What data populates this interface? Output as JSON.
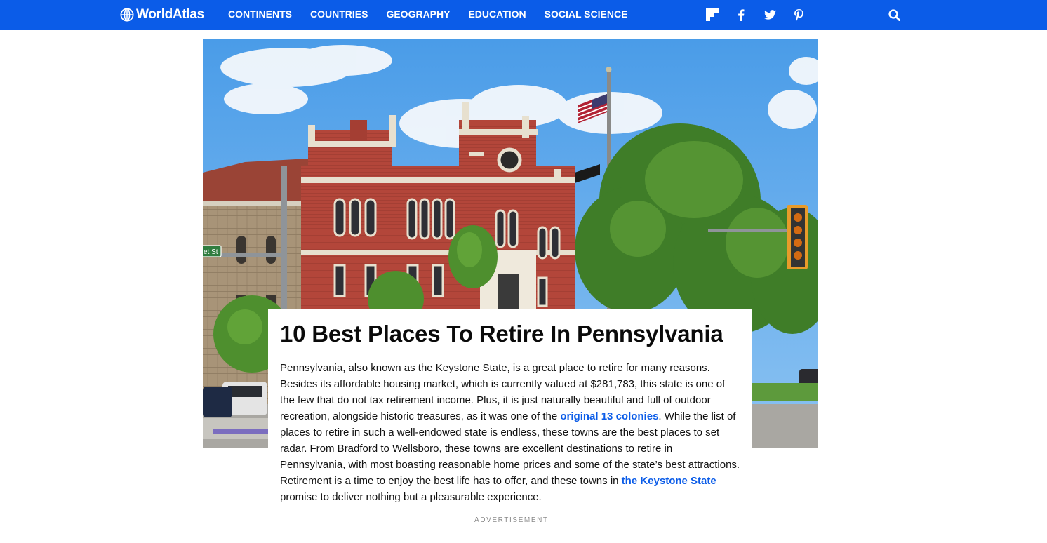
{
  "brand": {
    "name": "WorldAtlas"
  },
  "nav": {
    "items": [
      {
        "label": "CONTINENTS"
      },
      {
        "label": "COUNTRIES"
      },
      {
        "label": "GEOGRAPHY"
      },
      {
        "label": "EDUCATION"
      },
      {
        "label": "SOCIAL SCIENCE"
      }
    ]
  },
  "social": [
    "flipboard-icon",
    "facebook-icon",
    "twitter-icon",
    "pinterest-icon"
  ],
  "colors": {
    "nav_bg": "#0b5ce8",
    "link": "#0b5ce8"
  },
  "hero": {
    "sign_text": "et St"
  },
  "article": {
    "title": "10 Best Places To Retire In Pennsylvania",
    "intro_p1": "Pennsylvania, also known as the Keystone State, is a great place to retire for many reasons. Besides its affordable housing market, which is currently valued at $281,783, this state is one of the few that do not tax retirement income. Plus, it is just naturally beautiful and full of outdoor recreation, alongside historic treasures, as it was one of the ",
    "link1": "original 13 colonies",
    "intro_p2": ". While the list of places to retire in such a well-endowed state is endless, these towns are the best places to set radar. From Bradford to Wellsboro, these towns are excellent destinations to retire in Pennsylvania, with most boasting reasonable home prices and some of the state’s best attractions. Retirement is a time to enjoy the best life has to offer, and these towns in ",
    "link2": "the Keystone State",
    "intro_p3": " promise to deliver nothing but a pleasurable experience."
  },
  "ad": {
    "label": "ADVERTISEMENT"
  }
}
